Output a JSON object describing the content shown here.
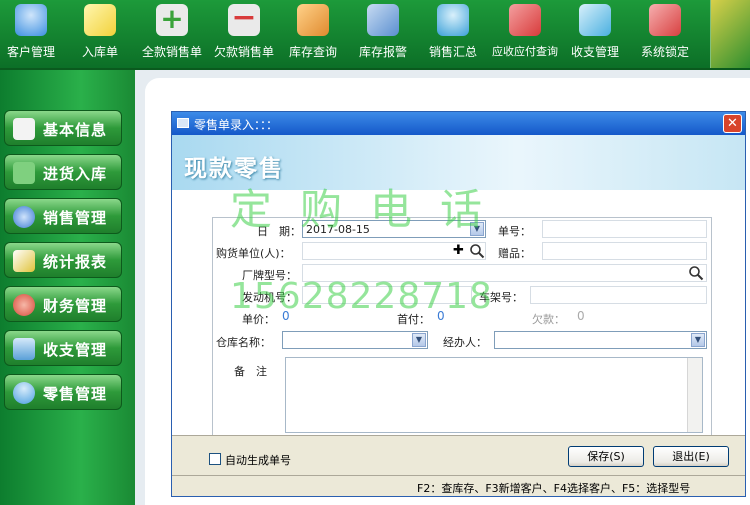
{
  "toolbar": {
    "items": [
      {
        "label": "客户管理",
        "icon": "user-icon",
        "color": "#3b8fe0"
      },
      {
        "label": "入库单",
        "icon": "notepad-pencil-icon",
        "color": "#f2d13a"
      },
      {
        "label": "全款销售单",
        "icon": "plus-icon",
        "color": "#4fbf4f"
      },
      {
        "label": "欠款销售单",
        "icon": "minus-icon",
        "color": "#e04b3b"
      },
      {
        "label": "库存查询",
        "icon": "box-arrow-icon",
        "color": "#e08a2e"
      },
      {
        "label": "库存报警",
        "icon": "folder-alert-icon",
        "color": "#5a8fd0"
      },
      {
        "label": "销售汇总",
        "icon": "people-icon",
        "color": "#3aa0d8"
      },
      {
        "label": "应收应付查询",
        "icon": "folder-search-icon",
        "color": "#d83b3b"
      },
      {
        "label": "收支管理",
        "icon": "book-icon",
        "color": "#4ab0e0"
      },
      {
        "label": "系统锁定",
        "icon": "folder-lock-icon",
        "color": "#d84040"
      }
    ]
  },
  "sidebar": {
    "items": [
      {
        "label": "基本信息",
        "icon": "document-check-icon",
        "color": "#f3f3f3"
      },
      {
        "label": "进货入库",
        "icon": "boxes-icon",
        "color": "#3cae3c"
      },
      {
        "label": "销售管理",
        "icon": "globe-icon",
        "color": "#3b7bd5"
      },
      {
        "label": "统计报表",
        "icon": "chart-icon",
        "color": "#e0c33a"
      },
      {
        "label": "财务管理",
        "icon": "money-icon",
        "color": "#d84a3a"
      },
      {
        "label": "收支管理",
        "icon": "card-icon",
        "color": "#5aa0d8"
      },
      {
        "label": "零售管理",
        "icon": "person-icon",
        "color": "#4a9fe0"
      }
    ]
  },
  "dialog": {
    "title": "零售单录入：：：",
    "close_glyph": "✕",
    "banner_title": "现款零售",
    "fields": {
      "date_label": "日　期：",
      "date_value": "2017-08-15",
      "order_no_label": "单号：",
      "buyer_label": "购货单位(人)：",
      "gift_label": "赠品：",
      "brand_model_label": "厂牌型号：",
      "engine_no_label": "发动机号：",
      "frame_no_label": "车架号：",
      "unit_price_label": "单价：",
      "unit_price_value": "0",
      "down_payment_label": "首付：",
      "down_payment_value": "0",
      "debt_label": "欠款：",
      "debt_value": "0",
      "warehouse_label": "仓库名称：",
      "handler_label": "经办人：",
      "remark_label": "备　注"
    },
    "watermark_line1": "定购电话",
    "watermark_line2": "15628228718",
    "auto_number_label": "自动生成单号",
    "save_button": "保存(S)",
    "exit_button": "退出(E)",
    "status_text": "F2：查库存、F3新增客户、F4选择客户、F5：选择型号"
  }
}
